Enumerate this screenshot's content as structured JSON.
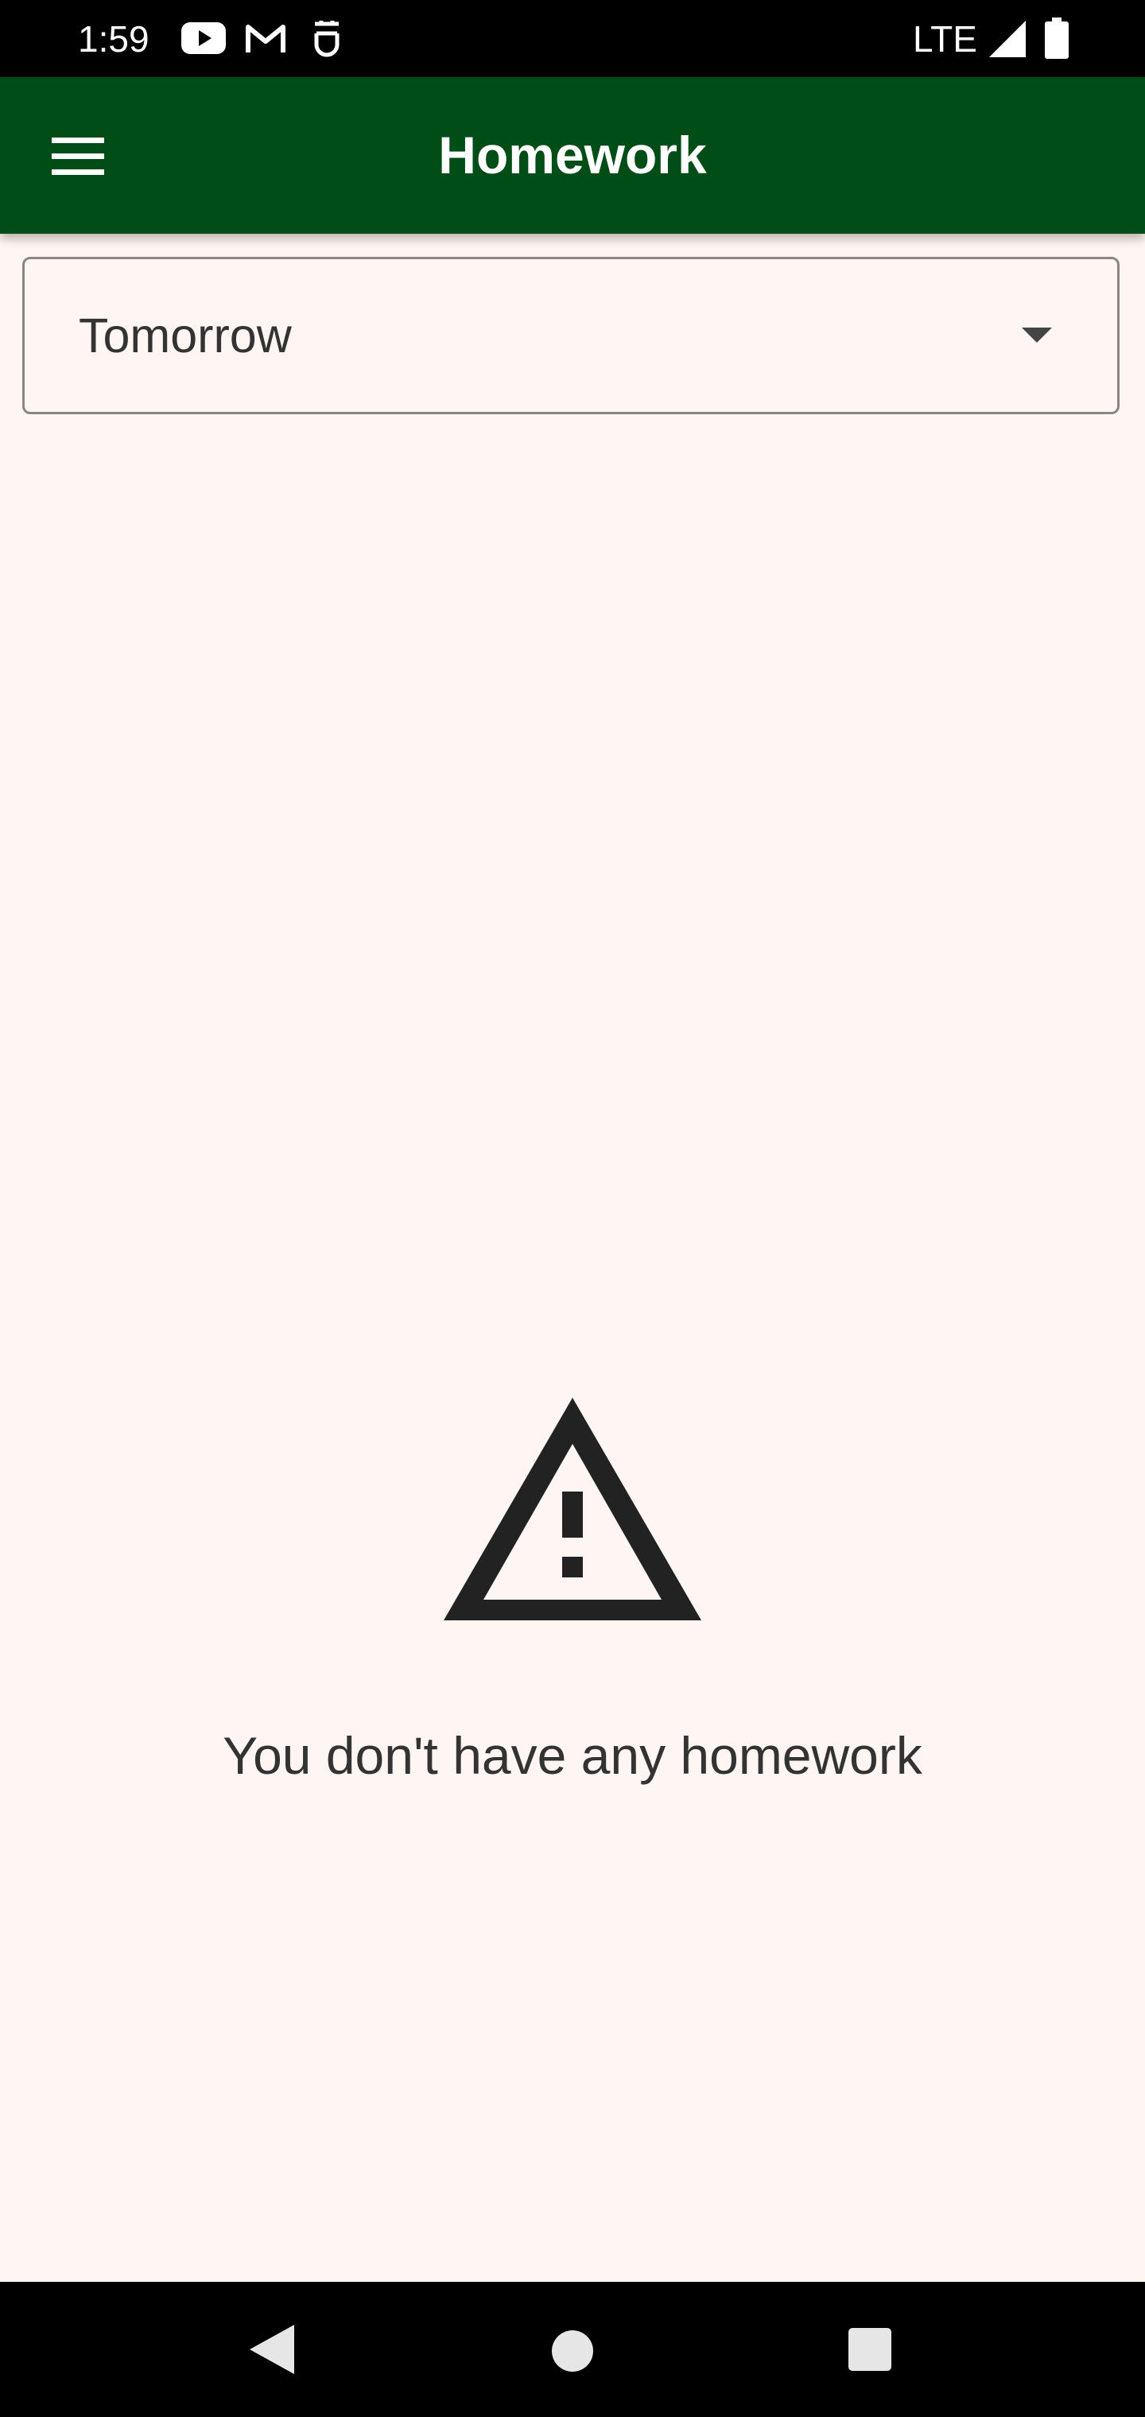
{
  "status_bar": {
    "time": "1:59",
    "network": "LTE",
    "left_icons": [
      "youtube-icon",
      "gmail-icon",
      "app-notification-icon"
    ],
    "right_icons": [
      "signal-icon",
      "battery-icon"
    ]
  },
  "app_bar": {
    "title": "Homework",
    "menu_icon": "hamburger-menu-icon",
    "background_color": "#004d17"
  },
  "filter": {
    "selected": "Tomorrow",
    "arrow_icon": "dropdown-arrow-icon"
  },
  "empty_state": {
    "icon": "warning-icon",
    "message": "You don't have any homework"
  },
  "nav_bar": {
    "buttons": [
      "back-icon",
      "home-icon",
      "recents-icon"
    ]
  },
  "colors": {
    "app_bar": "#004d17",
    "background": "#fff5f3",
    "text": "#333333"
  }
}
